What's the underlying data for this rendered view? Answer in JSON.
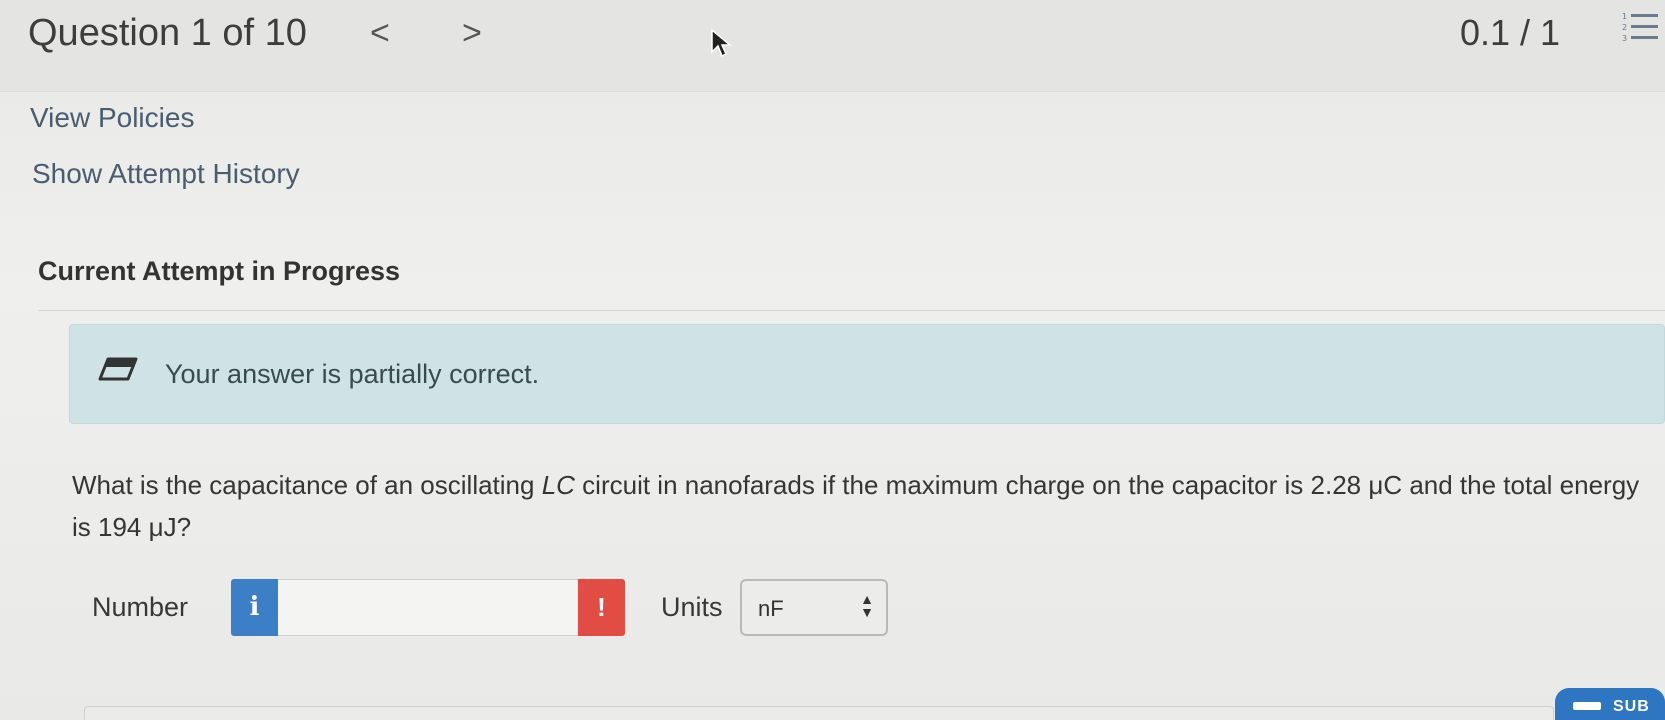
{
  "header": {
    "question_counter": "Question 1 of 10",
    "prev_glyph": "<",
    "next_glyph": ">",
    "score": "0.1 / 1"
  },
  "links": {
    "view_policies": "View Policies",
    "show_attempt_history": "Show Attempt History"
  },
  "attempt": {
    "title": "Current Attempt in Progress"
  },
  "feedback": {
    "message": "Your answer is partially correct."
  },
  "question": {
    "text_before": "What is the capacitance of an oscillating ",
    "italic_term": "LC",
    "text_after": " circuit in nanofarads if the maximum charge on the capacitor is 2.28 μC and the total energy is 194 μJ?"
  },
  "answer": {
    "number_label": "Number",
    "info_glyph": "i",
    "number_value": "",
    "warning_glyph": "!",
    "units_label": "Units",
    "units_selected": "nF"
  },
  "footer": {
    "submit_label": "SUB"
  },
  "colors": {
    "info": "#3d7fc7",
    "warning": "#e24d43",
    "banner": "#cfe3e6",
    "submit": "#2f76c2"
  }
}
